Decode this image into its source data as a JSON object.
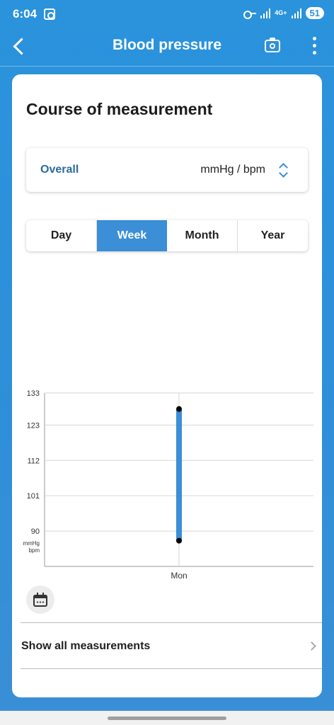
{
  "status_bar": {
    "time": "6:04",
    "network": "4G+",
    "battery": "51",
    "icons": [
      "screenshot-icon",
      "key-icon",
      "signal-icon",
      "signal-icon"
    ]
  },
  "app_bar": {
    "title": "Blood pressure",
    "back_icon": "back-icon",
    "camera_icon": "camera-icon",
    "more_icon": "more-icon"
  },
  "card": {
    "title": "Course of measurement",
    "overall_selector": {
      "label": "Overall",
      "unit": "mmHg / bpm",
      "icon": "chevron-up-down-icon"
    },
    "period_tabs": [
      {
        "label": "Day",
        "active": false
      },
      {
        "label": "Week",
        "active": true
      },
      {
        "label": "Month",
        "active": false
      },
      {
        "label": "Year",
        "active": false
      }
    ],
    "show_all_label": "Show all measurements",
    "calendar_icon": "calendar-icon"
  },
  "colors": {
    "accent": "#3a8fd6",
    "header_bg": "#2a93dc",
    "overall_label": "#2a6c9e",
    "range_bar": "#3a8fd6",
    "point": "#000000"
  },
  "chart_data": {
    "type": "range",
    "y_ticks": [
      133,
      123,
      112,
      101,
      90
    ],
    "y_unit": "mmHg\nbpm",
    "ylim": [
      79,
      133
    ],
    "categories": [
      "Mon"
    ],
    "series": [
      {
        "low": 87,
        "high": 128
      }
    ],
    "grid": true
  }
}
